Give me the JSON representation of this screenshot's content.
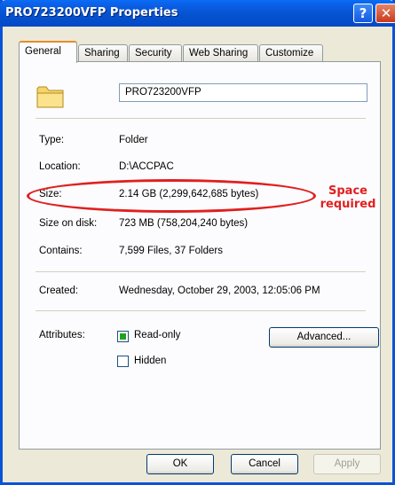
{
  "window": {
    "title": "PRO723200VFP Properties",
    "help_glyph": "?",
    "close_glyph": "✕"
  },
  "tabs": [
    {
      "label": "General"
    },
    {
      "label": "Sharing"
    },
    {
      "label": "Security"
    },
    {
      "label": "Web Sharing"
    },
    {
      "label": "Customize"
    }
  ],
  "general": {
    "name": "PRO723200VFP",
    "type_label": "Type:",
    "type_value": "Folder",
    "location_label": "Location:",
    "location_value": "D:\\ACCPAC",
    "size_label": "Size:",
    "size_value": "2.14 GB (2,299,642,685 bytes)",
    "size_on_disk_label": "Size on disk:",
    "size_on_disk_value": "723 MB (758,204,240 bytes)",
    "contains_label": "Contains:",
    "contains_value": "7,599 Files, 37 Folders",
    "created_label": "Created:",
    "created_value": "Wednesday, October 29, 2003, 12:05:06 PM",
    "attributes_label": "Attributes:",
    "readonly_label": "Read-only",
    "hidden_label": "Hidden",
    "advanced_label": "Advanced..."
  },
  "annotation": {
    "line1": "Space",
    "line2": "required",
    "color": "#e0201f"
  },
  "footer": {
    "ok_label": "OK",
    "cancel_label": "Cancel",
    "apply_label": "Apply"
  },
  "colors": {
    "title_bar": "#0553d0",
    "panel": "#fcfcfe",
    "dialog": "#ece9d8"
  }
}
